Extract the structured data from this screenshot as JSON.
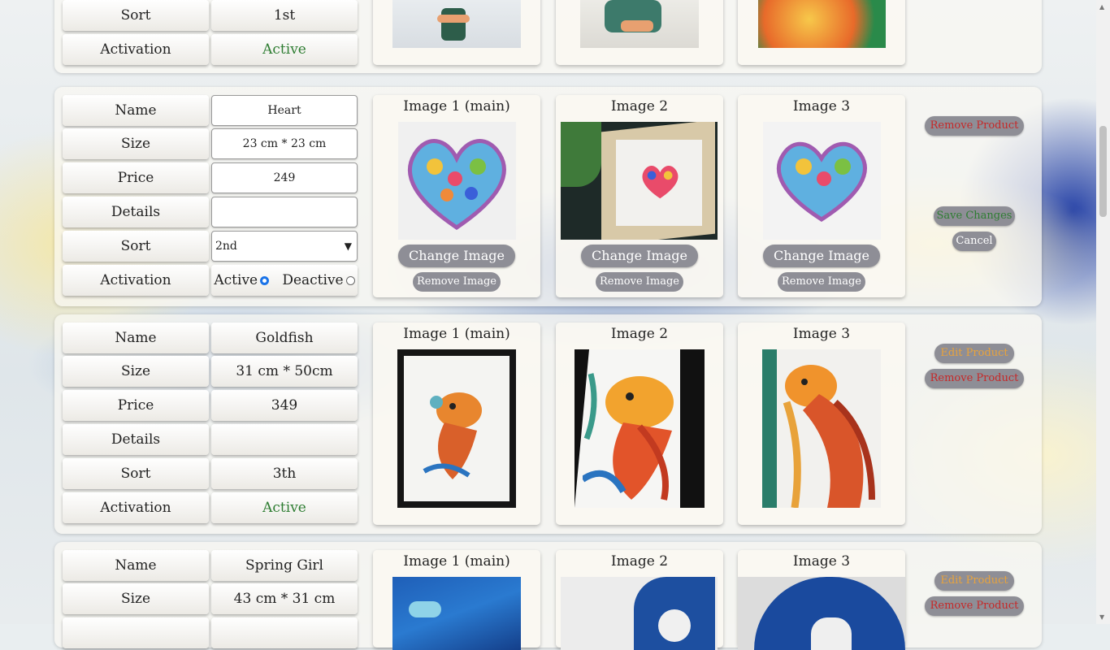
{
  "labels": {
    "name": "Name",
    "size": "Size",
    "price": "Price",
    "details": "Details",
    "sort": "Sort",
    "activation": "Activation"
  },
  "image_titles": [
    "Image 1 (main)",
    "Image 2",
    "Image 3"
  ],
  "buttons": {
    "change_image": "Change Image",
    "remove_image": "Remove Image",
    "remove_product": "Remove Product",
    "save_changes": "Save Changes",
    "cancel": "Cancel",
    "edit_product": "Edit Product"
  },
  "radio": {
    "active": "Active",
    "deactive": "Deactive"
  },
  "products": [
    {
      "sort": "1st",
      "activation": "Active"
    },
    {
      "name": "Heart",
      "size": "23 cm * 23 cm",
      "price": "249",
      "details": "",
      "sort": "2nd"
    },
    {
      "name": "Goldfish",
      "size": "31 cm * 50cm",
      "price": "349",
      "details": "",
      "sort": "3th",
      "activation": "Active"
    },
    {
      "name": "Spring Girl",
      "size": "43 cm * 31 cm"
    }
  ],
  "colors": {
    "red": "#c62828",
    "green": "#2e7d32",
    "orange": "#e8a33d",
    "button_gray": "#8e8e96"
  }
}
